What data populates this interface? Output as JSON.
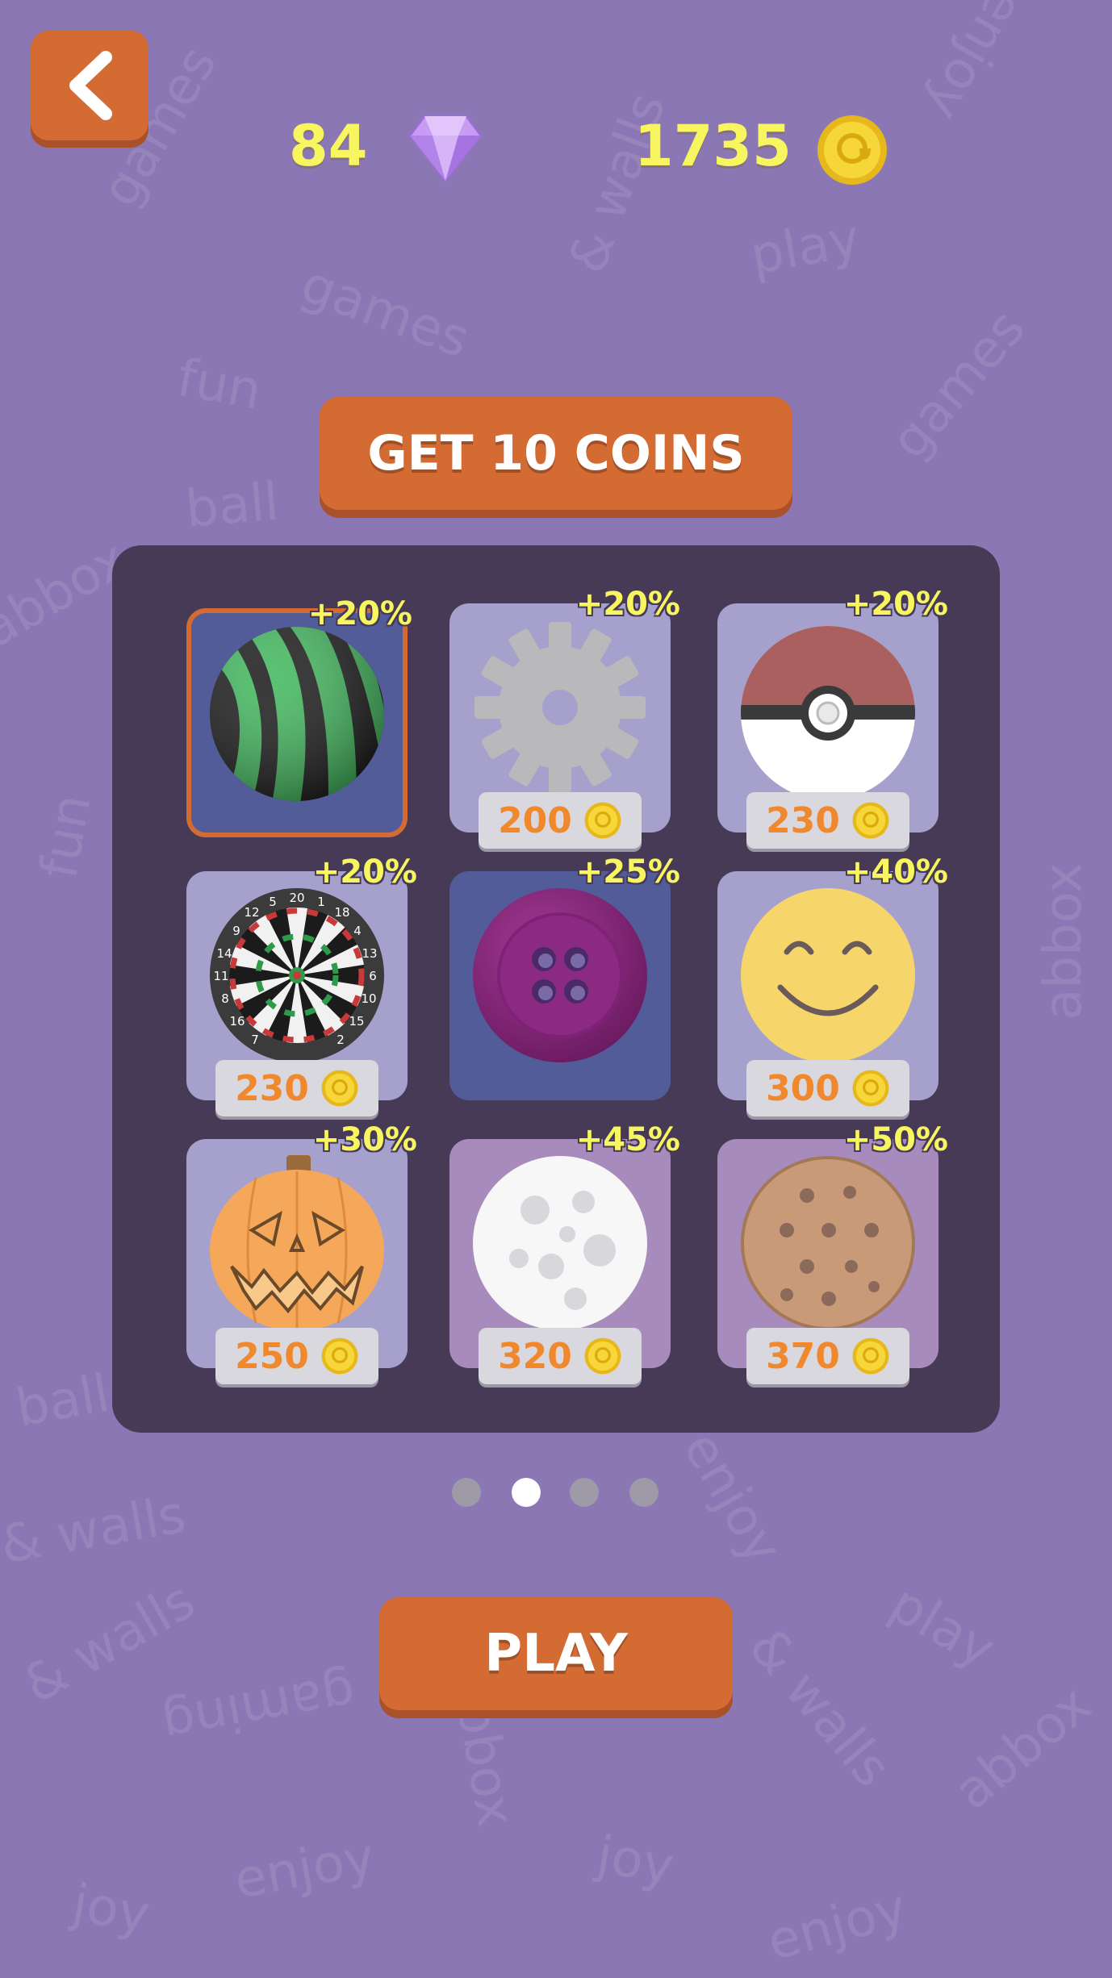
{
  "header": {
    "back_icon": "chevron-left-icon",
    "gems": "84",
    "gem_icon": "gem-icon",
    "coins": "1735",
    "coin_icon": "coin-icon"
  },
  "get_coins_label": "GET 10 COINS",
  "balls": [
    {
      "name": "striped-ball",
      "bonus": "+20%",
      "price": "",
      "selected": true,
      "bg": "blue"
    },
    {
      "name": "gear-ball",
      "bonus": "+20%",
      "price": "200",
      "selected": false,
      "bg": "light"
    },
    {
      "name": "pokeball",
      "bonus": "+20%",
      "price": "230",
      "selected": false,
      "bg": "light"
    },
    {
      "name": "dartboard-ball",
      "bonus": "+20%",
      "price": "230",
      "selected": false,
      "bg": "light"
    },
    {
      "name": "button-ball",
      "bonus": "+25%",
      "price": "",
      "selected": false,
      "bg": "blue"
    },
    {
      "name": "smiley-ball",
      "bonus": "+40%",
      "price": "300",
      "selected": false,
      "bg": "light"
    },
    {
      "name": "pumpkin-ball",
      "bonus": "+30%",
      "price": "250",
      "selected": false,
      "bg": "light"
    },
    {
      "name": "snowball",
      "bonus": "+45%",
      "price": "320",
      "selected": false,
      "bg": "pink"
    },
    {
      "name": "cookie-ball",
      "bonus": "+50%",
      "price": "370",
      "selected": false,
      "bg": "pink"
    }
  ],
  "pagination": {
    "pages": 4,
    "active": 1
  },
  "play_label": "PLAY",
  "colors": {
    "background": "#8b77b4",
    "button": "#d46b33",
    "counter_text": "#f7f560",
    "panel": "#463a56",
    "price_text": "#f0892d"
  },
  "watermark_words": [
    "games",
    "enjoy",
    "play",
    "fun",
    "ball",
    "& walls",
    "abbox",
    "joy",
    "gaming"
  ]
}
